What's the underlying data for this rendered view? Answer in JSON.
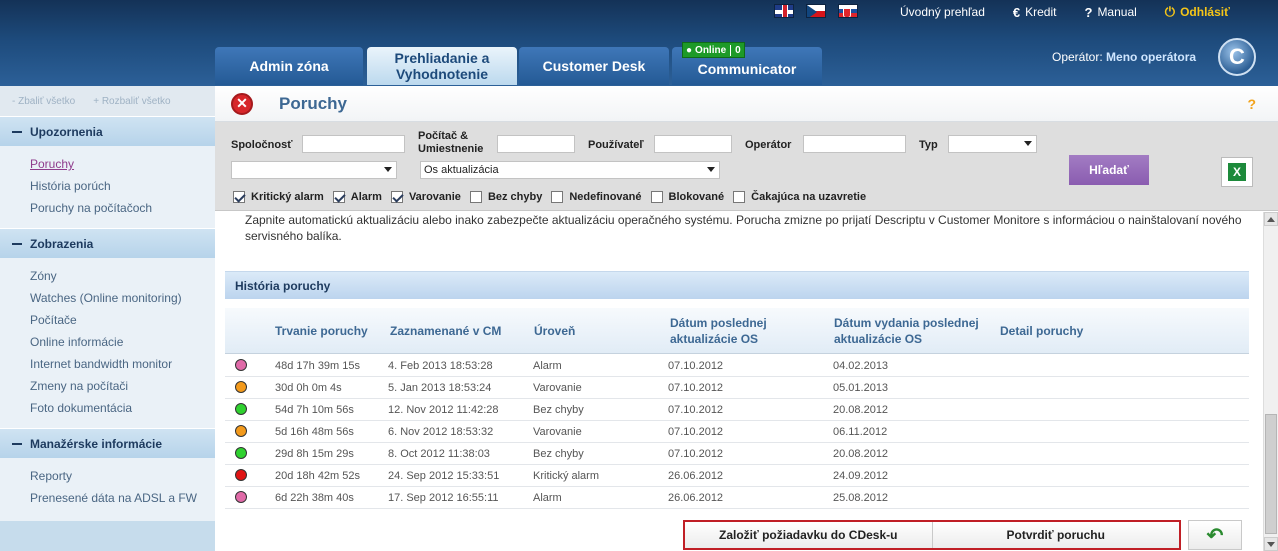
{
  "header": {
    "flags": [
      "flag-en-icon",
      "flag-cz-icon",
      "flag-sk-icon"
    ],
    "nav": [
      {
        "label": "Úvodný prehľad",
        "icon": ""
      },
      {
        "label": "Kredit",
        "icon": "€"
      },
      {
        "label": "Manual",
        "icon": "?"
      },
      {
        "label": "Odhlásiť",
        "icon": "⏻"
      }
    ],
    "tabs": [
      {
        "label": "Admin zóna"
      },
      {
        "label": "Prehliadanie a Vyhodnotenie"
      },
      {
        "label": "Customer Desk"
      },
      {
        "label": "Communicator"
      }
    ],
    "online": {
      "label": "Online",
      "count": "0"
    },
    "operator_label": "Operátor:",
    "operator_name": "Meno operátora",
    "logo": "C"
  },
  "sidebar": {
    "collapse_all": "- Zbaliť všetko",
    "expand_all": "+ Rozbaliť všetko",
    "sections": [
      {
        "title": "Upozornenia",
        "items": [
          "Poruchy",
          "História porúch",
          "Poruchy na počítačoch"
        ]
      },
      {
        "title": "Zobrazenia",
        "items": [
          "Zóny",
          "Watches (Online monitoring)",
          "Počítače",
          "Online informácie",
          "Internet bandwidth monitor",
          "Zmeny na počítači",
          "Foto dokumentácia"
        ]
      },
      {
        "title": "Manažérske informácie",
        "items": [
          "Reporty",
          "Prenesené dáta na ADSL a FW"
        ]
      }
    ]
  },
  "main": {
    "title": "Poruchy",
    "help": "?",
    "filter": {
      "company_label": "Spoločnosť",
      "computer_label": "Počítač & Umiestnenie",
      "user_label": "Používateľ",
      "operator_label": "Operátor",
      "type_label": "Typ",
      "type_value": "",
      "select1_value": "",
      "select2_value": "Os aktualizácia",
      "search_label": "Hľadať",
      "excel_label": "X",
      "checkboxes": [
        {
          "label": "Kritický alarm",
          "checked": true
        },
        {
          "label": "Alarm",
          "checked": true
        },
        {
          "label": "Varovanie",
          "checked": true
        },
        {
          "label": "Bez chyby",
          "checked": false
        },
        {
          "label": "Nedefinované",
          "checked": false
        },
        {
          "label": "Blokované",
          "checked": false
        },
        {
          "label": "Čakajúca na uzavretie",
          "checked": false
        }
      ]
    },
    "description": "Zapnite automatickú aktualizáciu alebo inako zabezpečte aktualizáciu operačného systému. Porucha zmizne po prijatí Descriptu v Customer Monitore s informáciou o nainštalovaní nového servisného balíka.",
    "history": {
      "title": "História poruchy",
      "columns": [
        "Trvanie poruchy",
        "Zaznamenané v CM",
        "Úroveň",
        "Dátum poslednej aktualizácie OS",
        "Dátum vydania poslednej aktualizácie OS",
        "Detail poruchy"
      ],
      "rows": [
        {
          "color": "#e06aa8",
          "duration": "48d 17h 39m 15s",
          "recorded": "4. Feb 2013 18:53:28",
          "level": "Alarm",
          "last_update": "07.10.2012",
          "release": "04.02.2013"
        },
        {
          "color": "#f39a1c",
          "duration": "30d 0h 0m 4s",
          "recorded": "5. Jan 2013 18:53:24",
          "level": "Varovanie",
          "last_update": "07.10.2012",
          "release": "05.01.2013"
        },
        {
          "color": "#2fd12f",
          "duration": "54d 7h 10m 56s",
          "recorded": "12. Nov 2012 11:42:28",
          "level": "Bez chyby",
          "last_update": "07.10.2012",
          "release": "20.08.2012"
        },
        {
          "color": "#f39a1c",
          "duration": "5d 16h 48m 56s",
          "recorded": "6. Nov 2012 18:53:32",
          "level": "Varovanie",
          "last_update": "07.10.2012",
          "release": "06.11.2012"
        },
        {
          "color": "#2fd12f",
          "duration": "29d 8h 15m 29s",
          "recorded": "8. Oct 2012 11:38:03",
          "level": "Bez chyby",
          "last_update": "07.10.2012",
          "release": "20.08.2012"
        },
        {
          "color": "#e01414",
          "duration": "20d 18h 42m 52s",
          "recorded": "24. Sep 2012 15:33:51",
          "level": "Kritický alarm",
          "last_update": "26.06.2012",
          "release": "24.09.2012"
        },
        {
          "color": "#e06aa8",
          "duration": "6d 22h 38m 40s",
          "recorded": "17. Sep 2012 16:55:11",
          "level": "Alarm",
          "last_update": "26.06.2012",
          "release": "25.08.2012"
        }
      ]
    },
    "actions": {
      "create_request": "Založiť požiadavku do CDesk-u",
      "confirm": "Potvrdiť poruchu",
      "back": "↶"
    },
    "colors": {
      "accent": "#3d6893",
      "search": "#8a5cb0",
      "highlight": "#c01f26"
    }
  }
}
